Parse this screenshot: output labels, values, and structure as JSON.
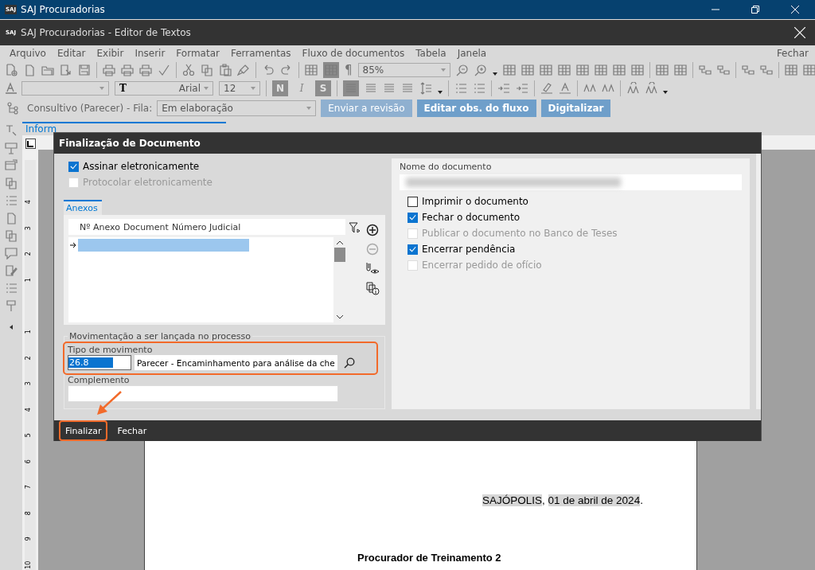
{
  "app_bar": {
    "logo": "SAJ",
    "title": "SAJ Procuradorias"
  },
  "editor_window": {
    "logo": "SAJ",
    "title": "SAJ Procuradorias - Editor de Textos"
  },
  "menu": [
    "Arquivo",
    "Editar",
    "Exibir",
    "Inserir",
    "Formatar",
    "Ferramentas",
    "Fluxo de documentos",
    "Tabela",
    "Janela"
  ],
  "menu_right": "Fechar",
  "toolbar": {
    "pilcrow": "¶",
    "zoom": "85%",
    "font_icon": "T",
    "font": "Arial",
    "size": "12",
    "bold": "N",
    "italic": "I",
    "strike": "S"
  },
  "flow_bar": {
    "label": "Consultivo (Parecer) - Fila:",
    "queue": "Em elaboração",
    "buttons": [
      {
        "label": "Enviar a revisão",
        "disabled": true
      },
      {
        "label": "Editar obs. do fluxo",
        "disabled": false
      },
      {
        "label": "Digitalizar",
        "disabled": false
      }
    ]
  },
  "tabs": [
    {
      "label": "Inform",
      "selected": true
    }
  ],
  "ruler": [
    "4",
    "3",
    "2",
    "1",
    "1",
    "2",
    "3",
    "4",
    "5",
    "6",
    "7",
    "8",
    "9",
    "10"
  ],
  "document": {
    "place": "SAJÓPOLIS",
    "separator": ",",
    "date": "01 de abril de 2024",
    "end": ".",
    "signer": "Procurador de Treinamento 2"
  },
  "dialog": {
    "title": "Finalização de Documento",
    "options_left": [
      {
        "label": "Assinar eletronicamente",
        "checked": true,
        "disabled": false
      },
      {
        "label": "Protocolar eletronicamente",
        "checked": false,
        "disabled": true
      }
    ],
    "attachments": {
      "tab": "Anexos",
      "columns": [
        "Nº Anexo",
        "Document",
        "Número Judicial"
      ],
      "rows": [
        {
          "selected": true
        }
      ]
    },
    "movement": {
      "legend": "Movimentação a ser lançada no processo",
      "type_label": "Tipo de movimento",
      "code": "26.8",
      "description": "Parecer - Encaminhamento para análise da che",
      "complement_label": "Complemento",
      "highlighted": true
    },
    "name_label": "Nome do documento",
    "name_redacted": true,
    "options_right": [
      {
        "label": "Imprimir o documento",
        "checked": false,
        "disabled": false
      },
      {
        "label": "Fechar o documento",
        "checked": true,
        "disabled": false
      },
      {
        "label": "Publicar o documento no Banco de Teses",
        "checked": false,
        "disabled": true
      },
      {
        "label": "Encerrar pendência",
        "checked": true,
        "disabled": false
      },
      {
        "label": "Encerrar pedido de ofício",
        "checked": false,
        "disabled": true
      }
    ],
    "buttons": [
      {
        "label": "Finalizar",
        "highlighted": true
      },
      {
        "label": "Fechar",
        "highlighted": false
      }
    ]
  }
}
